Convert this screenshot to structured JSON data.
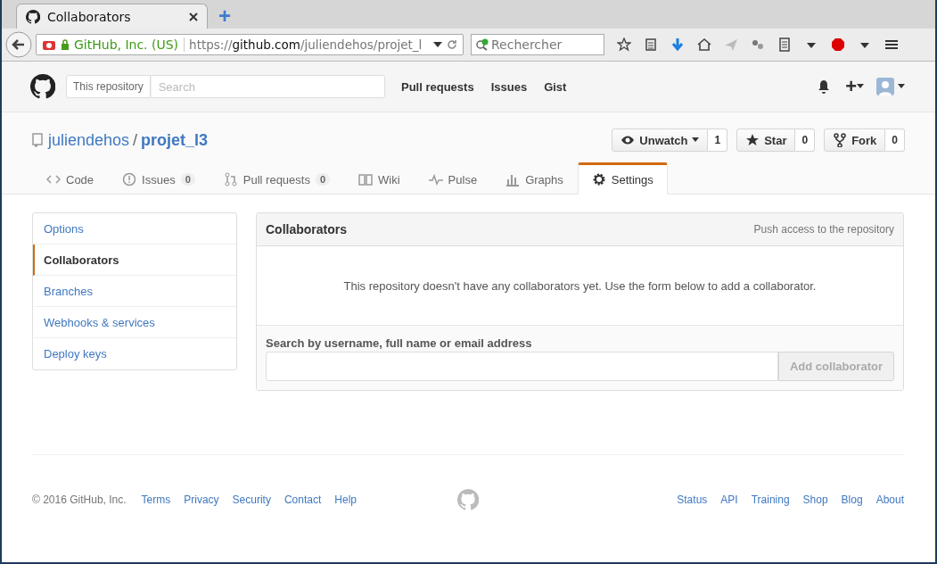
{
  "browser": {
    "tab_title": "Collaborators",
    "new_tab": "+",
    "identity": "GitHub, Inc. (US)",
    "url_scheme": "https://",
    "url_host": "github.com",
    "url_path": "/juliendehos/projet_l",
    "search_placeholder": "Rechercher"
  },
  "header": {
    "scope": "This repository",
    "search_placeholder": "Search",
    "nav": [
      "Pull requests",
      "Issues",
      "Gist"
    ],
    "plus": "+"
  },
  "repo": {
    "owner": "juliendehos",
    "separator": "/",
    "name": "projet_l3",
    "actions": [
      {
        "kind": "watch",
        "label": "Unwatch",
        "count": "1"
      },
      {
        "kind": "star",
        "label": "Star",
        "count": "0"
      },
      {
        "kind": "fork",
        "label": "Fork",
        "count": "0"
      }
    ]
  },
  "tabs": [
    {
      "kind": "code",
      "label": "Code",
      "selected": false
    },
    {
      "kind": "issues",
      "label": "Issues",
      "count": "0",
      "selected": false
    },
    {
      "kind": "pulls",
      "label": "Pull requests",
      "count": "0",
      "selected": false
    },
    {
      "kind": "wiki",
      "label": "Wiki",
      "selected": false
    },
    {
      "kind": "pulse",
      "label": "Pulse",
      "selected": false
    },
    {
      "kind": "graphs",
      "label": "Graphs",
      "selected": false
    },
    {
      "kind": "settings",
      "label": "Settings",
      "selected": true
    }
  ],
  "sidebar": {
    "items": [
      {
        "label": "Options",
        "selected": false
      },
      {
        "label": "Collaborators",
        "selected": true
      },
      {
        "label": "Branches",
        "selected": false
      },
      {
        "label": "Webhooks & services",
        "selected": false
      },
      {
        "label": "Deploy keys",
        "selected": false
      }
    ]
  },
  "panel": {
    "title": "Collaborators",
    "note": "Push access to the repository",
    "message": "This repository doesn't have any collaborators yet. Use the form below to add a collaborator.",
    "field_label": "Search by username, full name or email address",
    "button": {
      "label": "Add collaborator",
      "disabled": true
    }
  },
  "footer": {
    "copyright": "© 2016 GitHub, Inc.",
    "left_links": [
      "Terms",
      "Privacy",
      "Security",
      "Contact",
      "Help"
    ],
    "right_links": [
      "Status",
      "API",
      "Training",
      "Shop",
      "Blog",
      "About"
    ]
  }
}
